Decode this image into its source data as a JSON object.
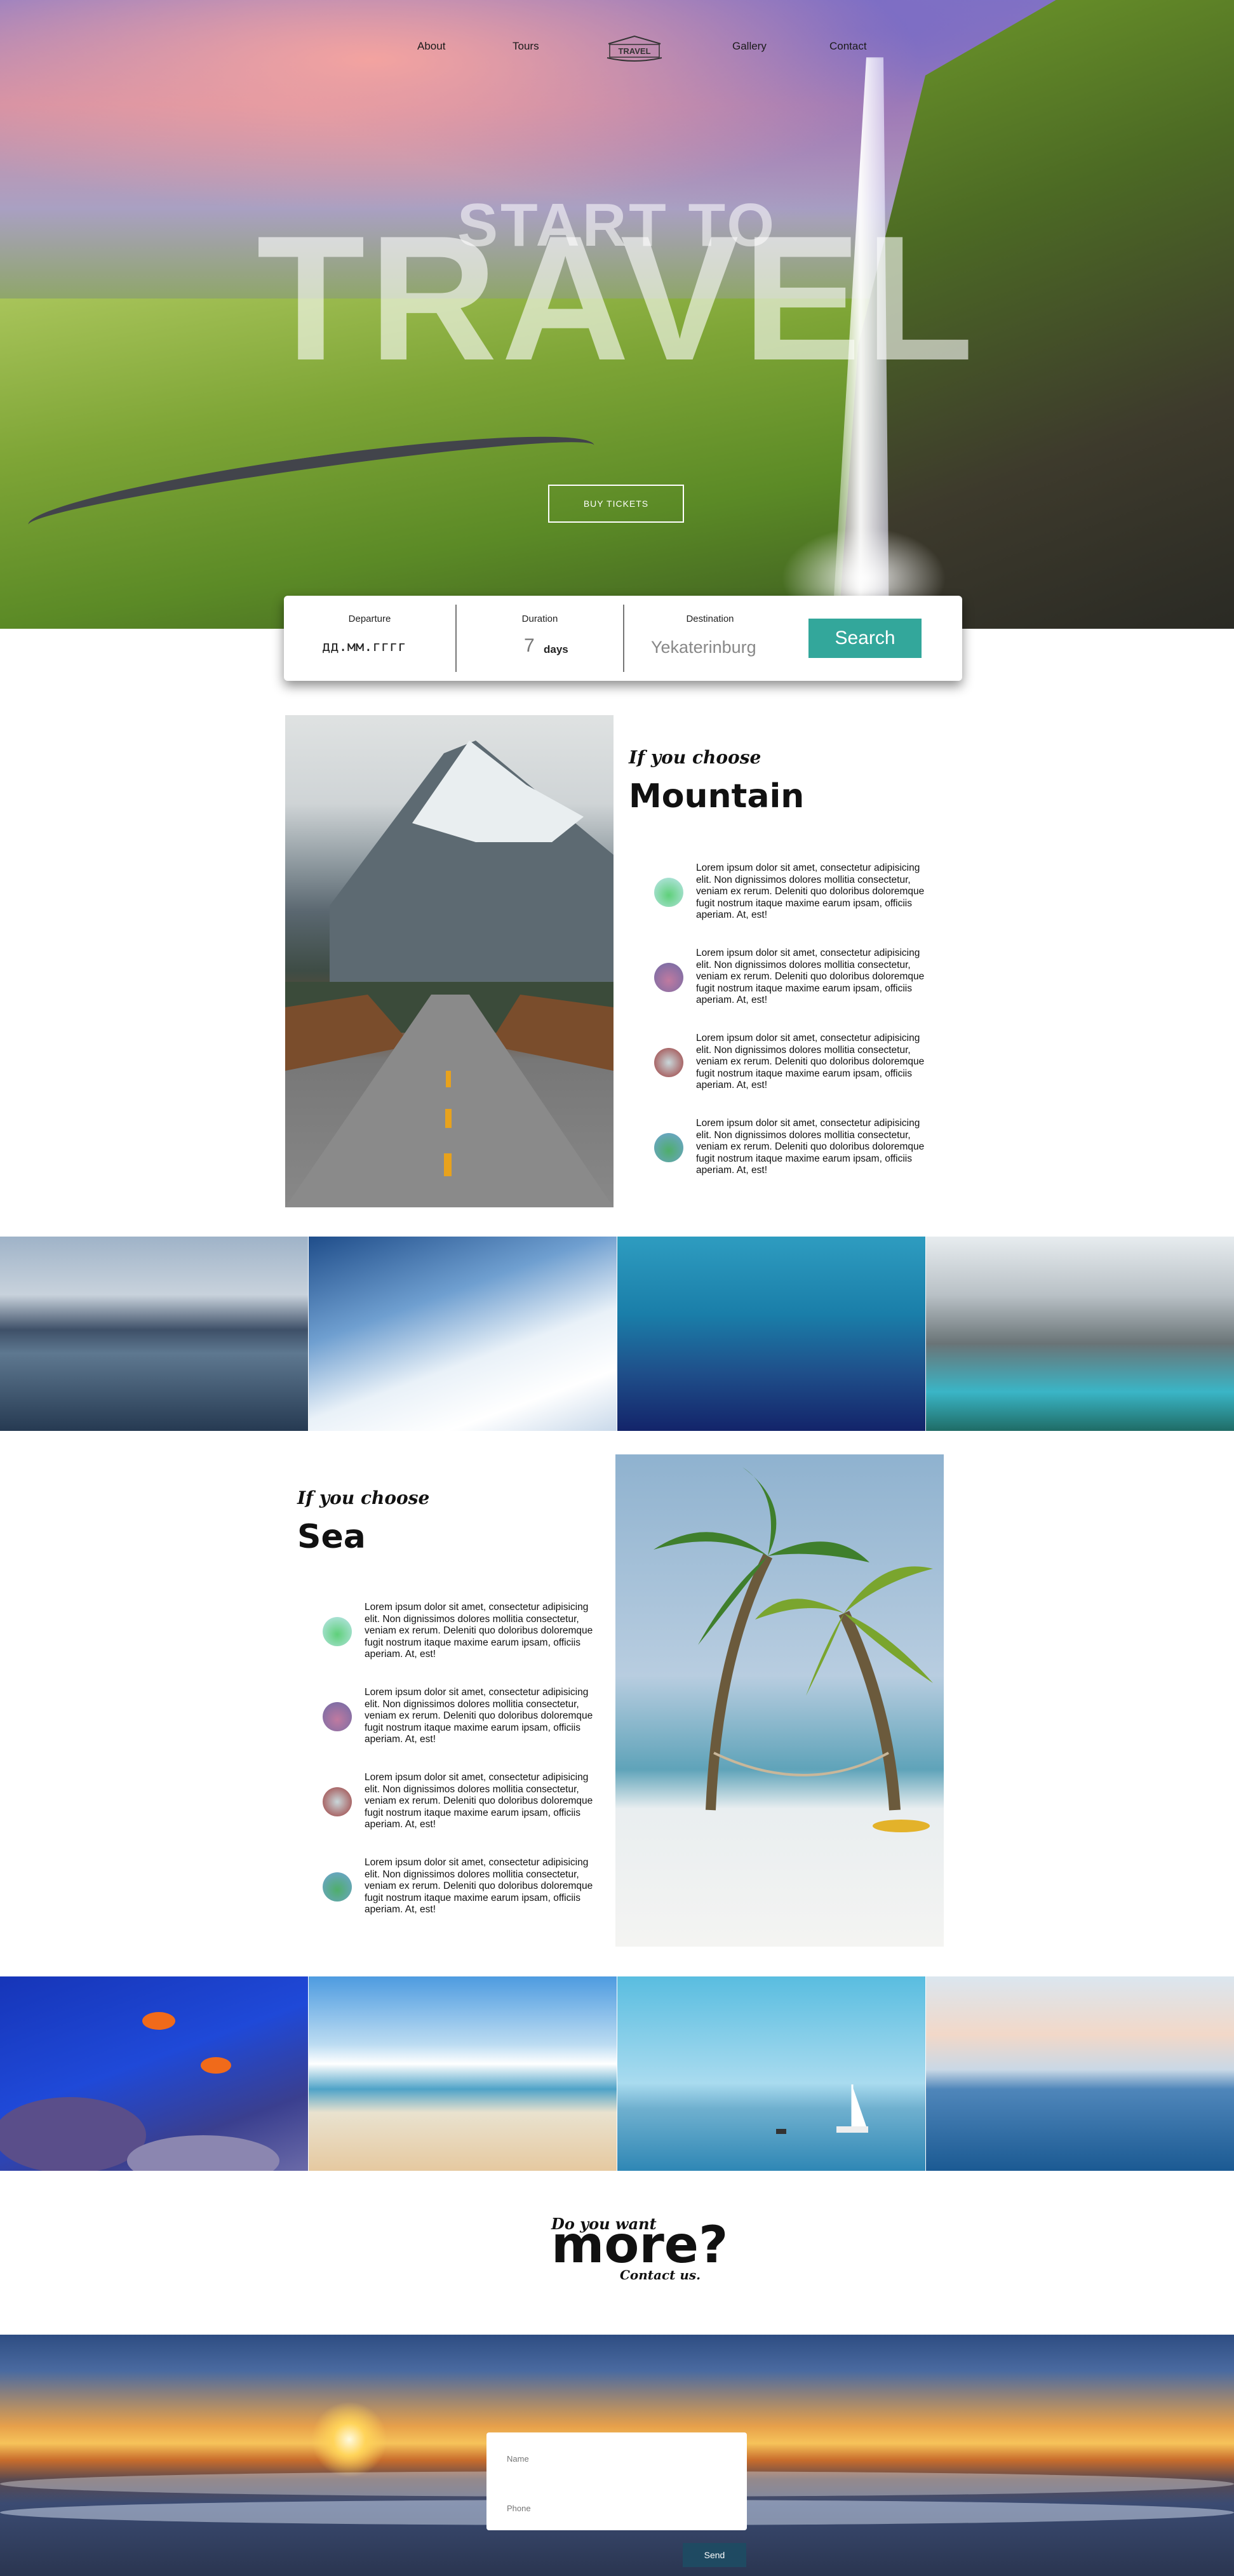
{
  "nav": {
    "about": "About",
    "tours": "Tours",
    "logo_text": "TRAVEL",
    "gallery": "Gallery",
    "contact": "Contact"
  },
  "hero": {
    "subtitle": "START TO",
    "title": "TRAVEL",
    "buy_button": "BUY TICKETS"
  },
  "search": {
    "departure_label": "Departure",
    "departure_placeholder": "дд.мм.гггг",
    "duration_label": "Duration",
    "duration_value": "7",
    "duration_unit": "days",
    "destination_label": "Destination",
    "destination_placeholder": "Yekaterinburg",
    "search_button": "Search"
  },
  "mountain": {
    "small": "If you choose",
    "big": "Mountain",
    "features": [
      "Lorem ipsum dolor sit amet, consectetur adipisicing elit. Non dignissimos dolores mollitia consectetur, veniam ex rerum. Deleniti quo doloribus doloremque fugit nostrum itaque maxime earum ipsam, officiis aperiam. At, est!",
      "Lorem ipsum dolor sit amet, consectetur adipisicing elit. Non dignissimos dolores mollitia consectetur, veniam ex rerum. Deleniti quo doloribus doloremque fugit nostrum itaque maxime earum ipsam, officiis aperiam. At, est!",
      "Lorem ipsum dolor sit amet, consectetur adipisicing elit. Non dignissimos dolores mollitia consectetur, veniam ex rerum. Deleniti quo doloribus doloremque fugit nostrum itaque maxime earum ipsam, officiis aperiam. At, est!",
      "Lorem ipsum dolor sit amet, consectetur adipisicing elit. Non dignissimos dolores mollitia consectetur, veniam ex rerum. Deleniti quo doloribus doloremque fugit nostrum itaque maxime earum ipsam, officiis aperiam. At, est!"
    ]
  },
  "sea": {
    "small": "If you choose",
    "big": "Sea",
    "features": [
      "Lorem ipsum dolor sit amet, consectetur adipisicing elit. Non dignissimos dolores mollitia consectetur, veniam ex rerum. Deleniti quo doloribus doloremque fugit nostrum itaque maxime earum ipsam, officiis aperiam. At, est!",
      "Lorem ipsum dolor sit amet, consectetur adipisicing elit. Non dignissimos dolores mollitia consectetur, veniam ex rerum. Deleniti quo doloribus doloremque fugit nostrum itaque maxime earum ipsam, officiis aperiam. At, est!",
      "Lorem ipsum dolor sit amet, consectetur adipisicing elit. Non dignissimos dolores mollitia consectetur, veniam ex rerum. Deleniti quo doloribus doloremque fugit nostrum itaque maxime earum ipsam, officiis aperiam. At, est!",
      "Lorem ipsum dolor sit amet, consectetur adipisicing elit. Non dignissimos dolores mollitia consectetur, veniam ex rerum. Deleniti quo doloribus doloremque fugit nostrum itaque maxime earum ipsam, officiis aperiam. At, est!"
    ]
  },
  "more": {
    "small": "Do you want",
    "big": "more?",
    "contact": "Contact us."
  },
  "form": {
    "name_placeholder": "Name",
    "phone_placeholder": "Phone",
    "send_button": "Send"
  },
  "colors": {
    "accent": "#33a79b",
    "send": "#1f4a62"
  }
}
